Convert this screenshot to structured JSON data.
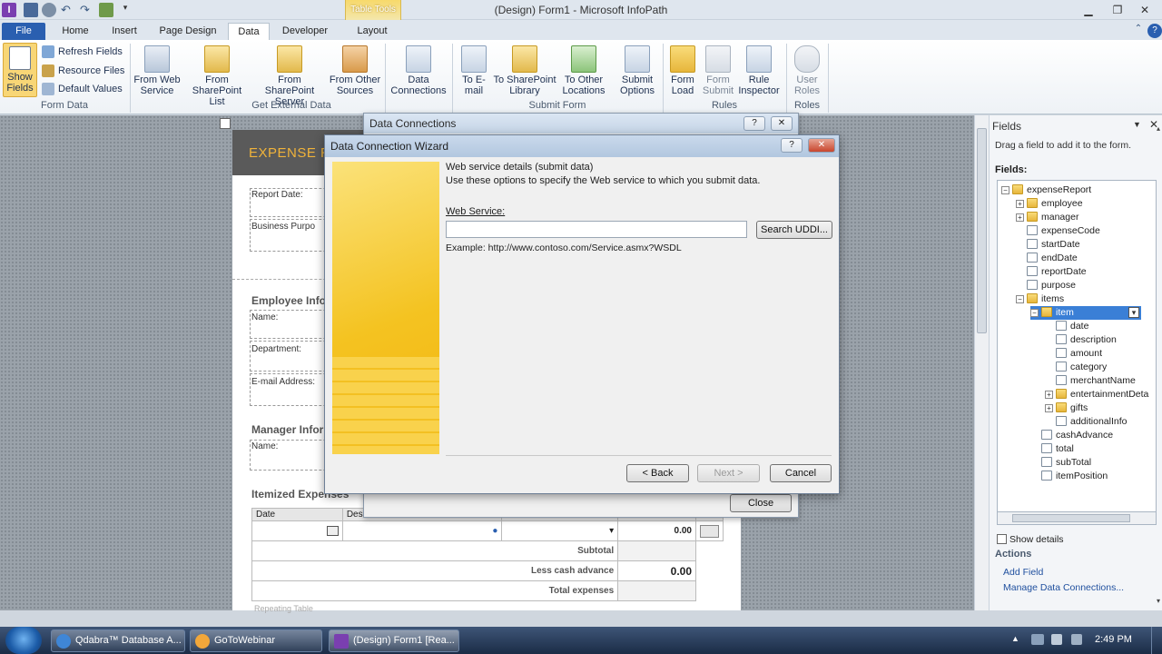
{
  "window": {
    "title": "(Design) Form1 - Microsoft InfoPath",
    "contextual_tab_group": "Table Tools"
  },
  "tabs": [
    "File",
    "Home",
    "Insert",
    "Page Design",
    "Data",
    "Developer",
    "Layout"
  ],
  "ribbon": {
    "form_data": {
      "show_fields": "Show Fields",
      "refresh_fields": "Refresh Fields",
      "resource_files": "Resource Files",
      "default_values": "Default Values",
      "group_label": "Form Data"
    },
    "get_external": {
      "from_web_service": "From Web Service",
      "from_sharepoint_list": "From SharePoint List",
      "from_sharepoint_server": "From SharePoint Server",
      "from_other_sources": "From Other Sources",
      "data_connections": "Data Connections",
      "group_label": "Get External Data"
    },
    "submit_form": {
      "to_email": "To E-mail",
      "to_sharepoint_library": "To SharePoint Library",
      "to_other_locations": "To Other Locations",
      "submit_options": "Submit Options",
      "group_label": "Submit Form"
    },
    "rules": {
      "form_load": "Form Load",
      "form_submit": "Form Submit",
      "rule_inspector": "Rule Inspector",
      "group_label": "Rules"
    },
    "roles": {
      "user_roles": "User Roles",
      "group_label": "Roles"
    }
  },
  "form": {
    "header": "EXPENSE R",
    "report_date": "Report Date:",
    "business_purpose": "Business Purpo",
    "employee_section": "Employee Info",
    "name": "Name:",
    "department": "Department:",
    "email": "E-mail Address:",
    "manager_section": "Manager Inform",
    "manager_name": "Name:",
    "itemized": "Itemized Expenses",
    "col_date": "Date",
    "col_desc": "Desc",
    "amount_zero": "0.00",
    "subtotal": "Subtotal",
    "less_cash": "Less cash advance",
    "less_cash_val": "0.00",
    "total_expenses": "Total expenses",
    "repeating_table": "Repeating Table"
  },
  "data_connections_dialog": {
    "title": "Data Connections",
    "close": "Close"
  },
  "wizard": {
    "title": "Data Connection Wizard",
    "heading": "Web service details (submit data)",
    "description": "Use these options to specify the Web service to which you submit data.",
    "web_service_label": "Web Service:",
    "web_service_value": "",
    "search_uddi": "Search UDDI...",
    "example": "Example: http://www.contoso.com/Service.asmx?WSDL",
    "back": "< Back",
    "next": "Next >",
    "cancel": "Cancel"
  },
  "fields_pane": {
    "title": "Fields",
    "hint": "Drag a field to add it to the form.",
    "fields_label": "Fields:",
    "tree": [
      {
        "label": "expenseReport",
        "type": "folder",
        "level": 0,
        "expander": "−"
      },
      {
        "label": "employee",
        "type": "folder",
        "level": 1,
        "expander": "+"
      },
      {
        "label": "manager",
        "type": "folder",
        "level": 1,
        "expander": "+"
      },
      {
        "label": "expenseCode",
        "type": "field",
        "level": 1,
        "expander": ""
      },
      {
        "label": "startDate",
        "type": "field",
        "level": 1,
        "expander": ""
      },
      {
        "label": "endDate",
        "type": "field",
        "level": 1,
        "expander": ""
      },
      {
        "label": "reportDate",
        "type": "field",
        "level": 1,
        "expander": ""
      },
      {
        "label": "purpose",
        "type": "field",
        "level": 1,
        "expander": ""
      },
      {
        "label": "items",
        "type": "folder",
        "level": 1,
        "expander": "−"
      },
      {
        "label": "item",
        "type": "folder",
        "level": 2,
        "expander": "−",
        "selected": true
      },
      {
        "label": "date",
        "type": "field",
        "level": 3,
        "expander": ""
      },
      {
        "label": "description",
        "type": "field",
        "level": 3,
        "expander": ""
      },
      {
        "label": "amount",
        "type": "field",
        "level": 3,
        "expander": ""
      },
      {
        "label": "category",
        "type": "field",
        "level": 3,
        "expander": ""
      },
      {
        "label": "merchantName",
        "type": "field",
        "level": 3,
        "expander": ""
      },
      {
        "label": "entertainmentDeta",
        "type": "folder",
        "level": 3,
        "expander": "+"
      },
      {
        "label": "gifts",
        "type": "folder",
        "level": 3,
        "expander": "+"
      },
      {
        "label": "additionalInfo",
        "type": "field",
        "level": 3,
        "expander": ""
      },
      {
        "label": "cashAdvance",
        "type": "field",
        "level": 2,
        "expander": ""
      },
      {
        "label": "total",
        "type": "field",
        "level": 2,
        "expander": ""
      },
      {
        "label": "subTotal",
        "type": "field",
        "level": 2,
        "expander": ""
      },
      {
        "label": "itemPosition",
        "type": "field",
        "level": 2,
        "expander": ""
      }
    ],
    "show_details": "Show details",
    "actions": "Actions",
    "add_field": "Add Field",
    "manage_data_connections": "Manage Data Connections..."
  },
  "taskbar": {
    "items": [
      "Qdabra™ Database A...",
      "GoToWebinar",
      "(Design) Form1 [Rea..."
    ],
    "clock": "2:49 PM"
  }
}
